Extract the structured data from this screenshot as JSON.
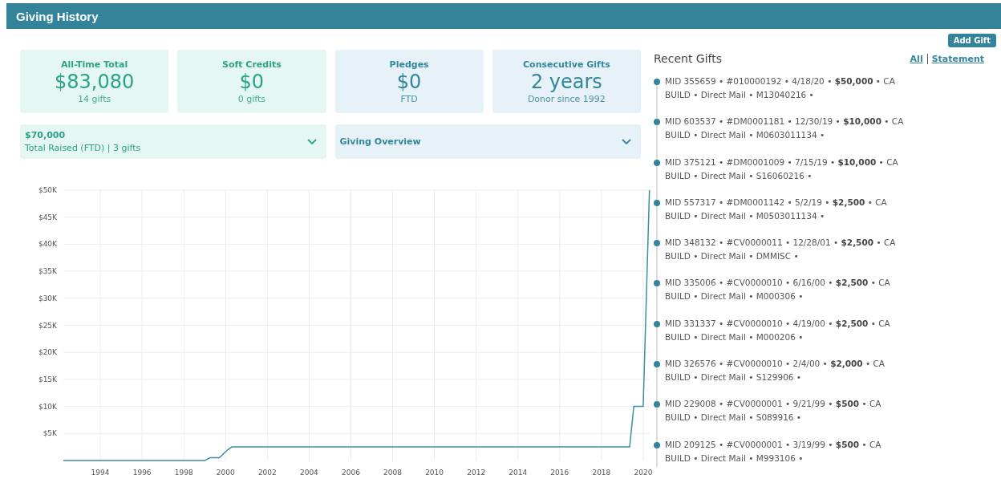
{
  "header": {
    "title": "Giving History"
  },
  "add_gift_button": "Add Gift",
  "stats": [
    {
      "label": "All-Time Total",
      "value": "$83,080",
      "sub": "14 gifts",
      "kind": "green"
    },
    {
      "label": "Soft Credits",
      "value": "$0",
      "sub": "0 gifts",
      "kind": "green"
    },
    {
      "label": "Pledges",
      "value": "$0",
      "sub": "FTD",
      "kind": "blue"
    },
    {
      "label": "Consecutive Gifts",
      "value": "2 years",
      "sub": "Donor since 1992",
      "kind": "blue"
    }
  ],
  "dropdowns": [
    {
      "title": "$70,000",
      "subtitle": "Total Raised (FTD) | 3 gifts",
      "kind": "green",
      "expanded": false
    },
    {
      "title": "Giving Overview",
      "kind": "blue",
      "expanded": false
    }
  ],
  "chart": {
    "chart_data": {
      "type": "line",
      "x": [
        1992.23,
        1999.0,
        1999.25,
        1999.7,
        2000.1,
        2000.3,
        2019.35,
        2019.55,
        2020.0,
        2020.3
      ],
      "grid": true,
      "series": [
        {
          "color": "#3a8fa3",
          "values": [
            0,
            0,
            500,
            500,
            2000,
            2500,
            2500,
            10000,
            10000,
            50000
          ]
        }
      ],
      "xlim": [
        1992.23,
        2020.31
      ],
      "ylim": [
        0,
        50000
      ],
      "xticks": [
        1994,
        1996,
        1998,
        2000,
        2002,
        2004,
        2006,
        2008,
        2010,
        2012,
        2014,
        2016,
        2018,
        2020
      ],
      "yticks": [
        {
          "value": 5000,
          "label": "$5K"
        },
        {
          "value": 10000,
          "label": "$10K"
        },
        {
          "value": 15000,
          "label": "$15K"
        },
        {
          "value": 20000,
          "label": "$20K"
        },
        {
          "value": 25000,
          "label": "$25K"
        },
        {
          "value": 30000,
          "label": "$30K"
        },
        {
          "value": 35000,
          "label": "$35K"
        },
        {
          "value": 40000,
          "label": "$40K"
        },
        {
          "value": 45000,
          "label": "$45K"
        },
        {
          "value": 50000,
          "label": "$50K"
        }
      ]
    }
  },
  "recent_gifts": {
    "title": "Recent Gifts",
    "links": [
      "All",
      "Statement"
    ],
    "items": [
      {
        "line_1": "MID 355659 • #010000192 • 4/18/20 • **$50,000** • CA",
        "line_2": "BUILD • Direct Mail • M13040216 •"
      },
      {
        "line_1": "MID 603537 • #DM0001181 • 12/30/19 • **$10,000** • CA",
        "line_2": "BUILD • Direct Mail • M0603011134 •"
      },
      {
        "line_1": "MID 375121 • #DM0001009 • 7/15/19 • **$10,000** • CA",
        "line_2": "BUILD • Direct Mail • S16060216 •"
      },
      {
        "line_1": "MID 557317 • #DM0001142 • 5/2/19 • **$2,500** • CA",
        "line_2": "BUILD • Direct Mail • M0503011134 •"
      },
      {
        "line_1": "MID 348132 • #CV0000011 • 12/28/01 • **$2,500** • CA",
        "line_2": "BUILD • Direct Mail • DMMISC •"
      },
      {
        "line_1": "MID 335006 • #CV0000010 • 6/16/00 • **$2,500** • CA",
        "line_2": "BUILD • Direct Mail • M000306 •"
      },
      {
        "line_1": "MID 331337 • #CV0000010 • 4/19/00 • **$2,500** • CA",
        "line_2": "BUILD • Direct Mail • M000206 •"
      },
      {
        "line_1": "MID 326576 • #CV0000010 • 2/4/00 • **$2,000** • CA",
        "line_2": "BUILD • Direct Mail • S129906 •"
      },
      {
        "line_1": "MID 229008 • #CV0000001 • 9/21/99 • **$500** • CA",
        "line_2": "BUILD • Direct Mail • S089916 •"
      },
      {
        "line_1": "MID 209125 • #CV0000001 • 3/19/99 • **$500** • CA",
        "line_2": "BUILD • Direct Mail • M993106 •"
      }
    ]
  }
}
